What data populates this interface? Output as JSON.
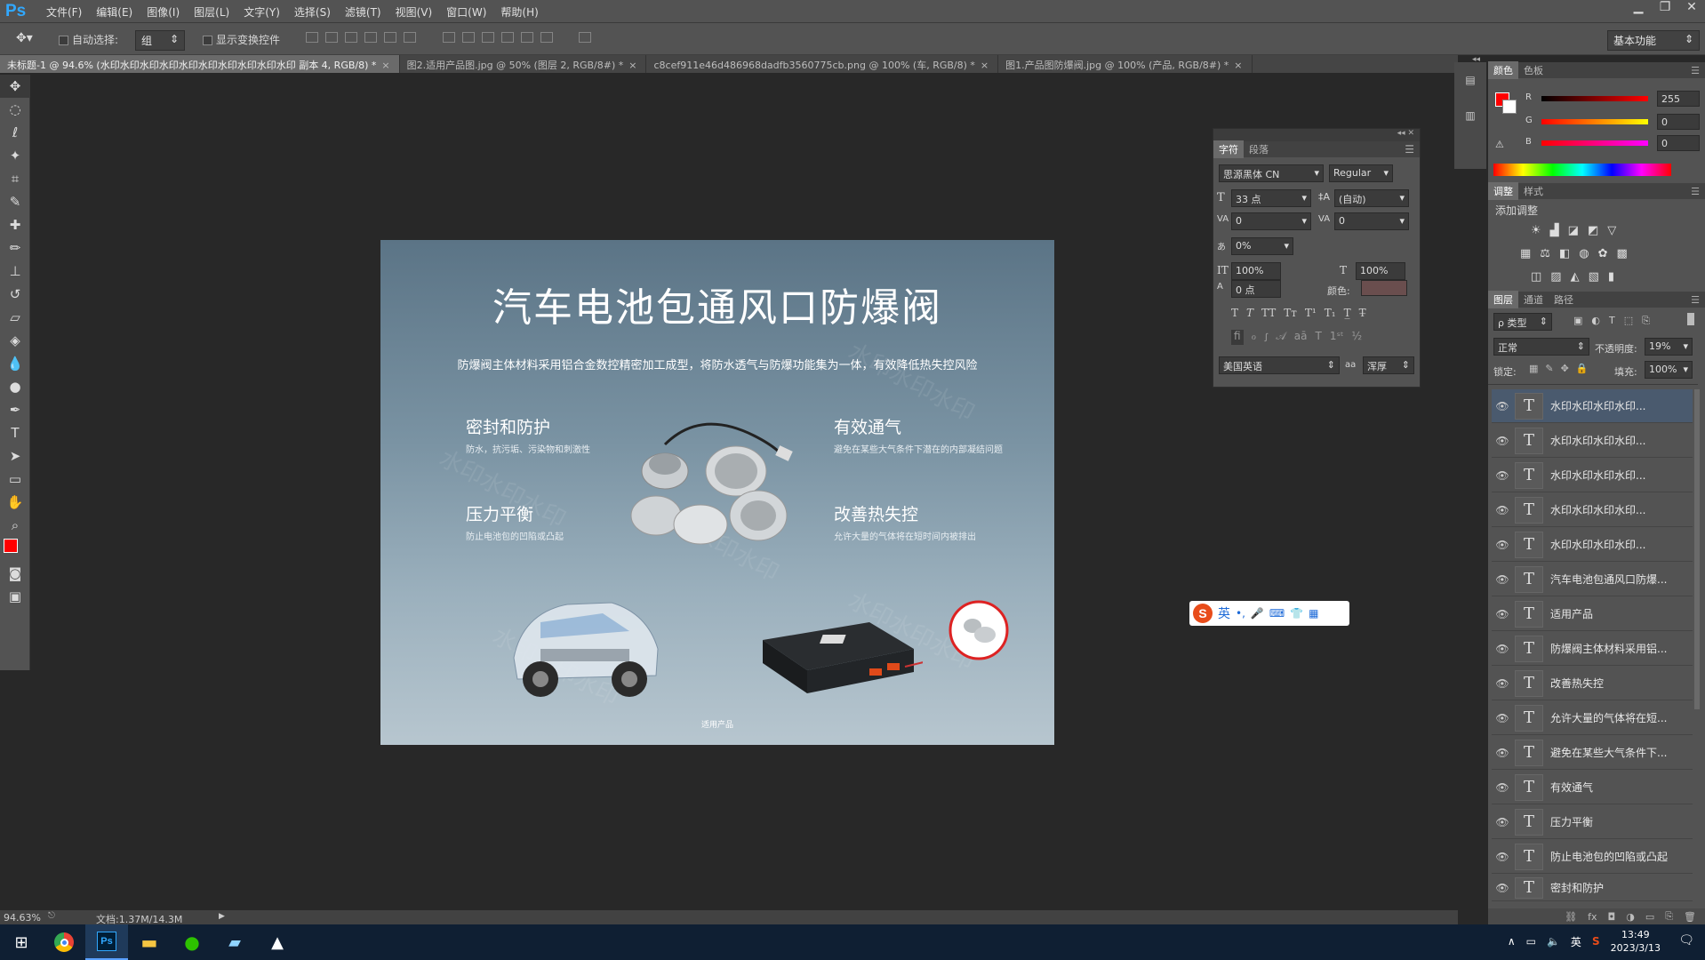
{
  "app": {
    "logo": "Ps"
  },
  "menu": [
    "文件(F)",
    "编辑(E)",
    "图像(I)",
    "图层(L)",
    "文字(Y)",
    "选择(S)",
    "滤镜(T)",
    "视图(V)",
    "窗口(W)",
    "帮助(H)"
  ],
  "options": {
    "auto_select_label": "自动选择:",
    "auto_select_value": "组",
    "show_transform_label": "显示变换控件",
    "workspace": "基本功能"
  },
  "tabs": [
    {
      "label": "未标题-1 @ 94.6% (水印水印水印水印水印水印水印水印水印水印 副本 4, RGB/8) *"
    },
    {
      "label": "图2.适用产品图.jpg @ 50% (图层 2, RGB/8#) *"
    },
    {
      "label": "c8cef911e46d486968dadfb3560775cb.png @ 100% (车, RGB/8) *"
    },
    {
      "label": "图1.产品图防爆阀.jpg @ 100% (产品, RGB/8#) *"
    }
  ],
  "document": {
    "title": "汽车电池包通风口防爆阀",
    "subtitle": "防爆阀主体材料采用铝合金数控精密加工成型，将防水透气与防爆功能集为一体，有效降低热失控风险",
    "features": [
      {
        "heading": "密封和防护",
        "text": "防水，抗污垢、污染物和刺激性"
      },
      {
        "heading": "有效通气",
        "text": "避免在某些大气条件下潜在的内部凝结问题"
      },
      {
        "heading": "压力平衡",
        "text": "防止电池包的凹陷或凸起"
      },
      {
        "heading": "改善热失控",
        "text": "允许大量的气体将在短时间内被排出"
      }
    ],
    "footer": "适用产品",
    "watermark": "水印水印水印"
  },
  "character_panel": {
    "tab_char": "字符",
    "tab_para": "段落",
    "font_family": "思源黑体 CN",
    "font_style": "Regular",
    "size": "33 点",
    "leading": "(自动)",
    "kerning": "0",
    "tracking": "0",
    "tsume": "0%",
    "vscale": "100%",
    "hscale": "100%",
    "baseline": "0 点",
    "color_label": "颜色:",
    "language": "美国英语",
    "aa_label": "aa",
    "aa_value": "浑厚"
  },
  "color_panel": {
    "tab_color": "颜色",
    "tab_swatch": "色板",
    "r_label": "R",
    "r": "255",
    "g_label": "G",
    "g": "0",
    "b_label": "B",
    "b": "0",
    "foreground": "#ff0000"
  },
  "adjust_panel": {
    "tab_adjust": "调整",
    "tab_style": "样式",
    "add_label": "添加调整"
  },
  "layers_panel": {
    "tab_layers": "图层",
    "tab_channels": "通道",
    "tab_paths": "路径",
    "filter_label": "ρ 类型",
    "blend_mode": "正常",
    "opacity_label": "不透明度:",
    "opacity": "19%",
    "lock_label": "锁定:",
    "fill_label": "填充:",
    "fill": "100%",
    "layers": [
      {
        "name": "水印水印水印水印..."
      },
      {
        "name": "水印水印水印水印..."
      },
      {
        "name": "水印水印水印水印..."
      },
      {
        "name": "水印水印水印水印..."
      },
      {
        "name": "水印水印水印水印..."
      },
      {
        "name": "汽车电池包通风口防爆..."
      },
      {
        "name": "适用产品"
      },
      {
        "name": "防爆阀主体材料采用铝..."
      },
      {
        "name": "改善热失控"
      },
      {
        "name": "允许大量的气体将在短..."
      },
      {
        "name": "避免在某些大气条件下..."
      },
      {
        "name": "有效通气"
      },
      {
        "name": "压力平衡"
      },
      {
        "name": "防止电池包的凹陷或凸起"
      },
      {
        "name": "密封和防护"
      }
    ]
  },
  "status": {
    "zoom": "94.63%",
    "doc": "文档:1.37M/14.3M"
  },
  "ime": {
    "lang": "英"
  },
  "taskbar": {
    "time": "13:49",
    "date": "2023/3/13",
    "ime_indicator": "英"
  }
}
